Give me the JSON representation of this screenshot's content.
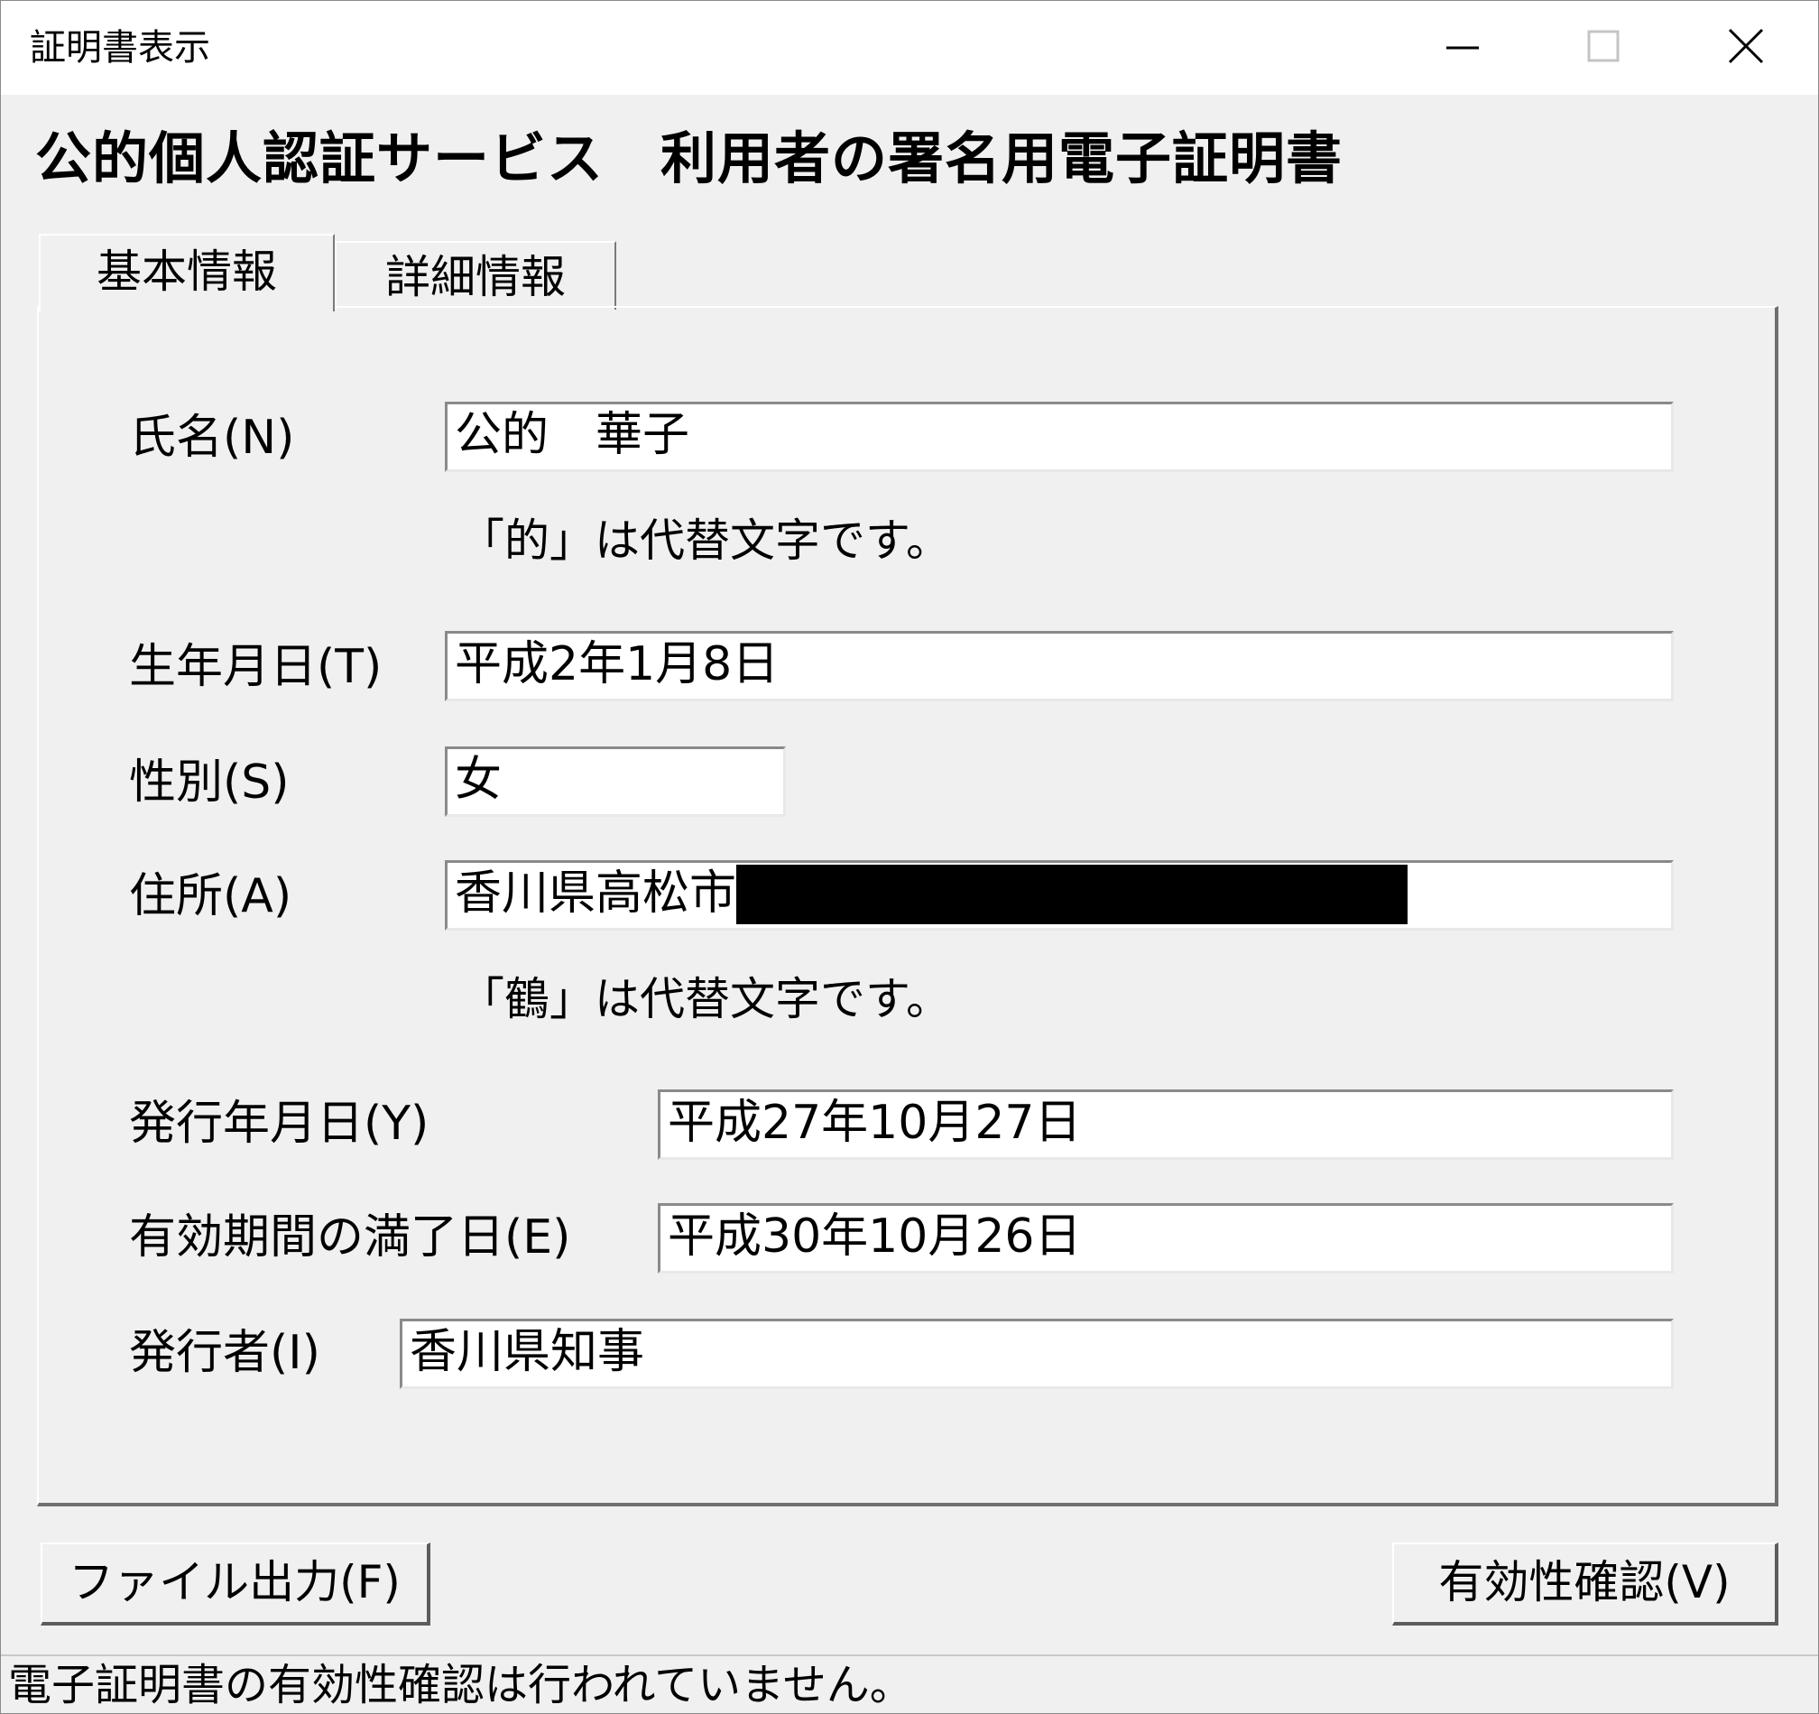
{
  "window": {
    "title": "証明書表示",
    "controls": {
      "minimize": "minimize-icon",
      "maximize": "maximize-icon",
      "close": "close-icon"
    }
  },
  "heading": "公的個人認証サービス　利用者の署名用電子証明書",
  "tabs": [
    {
      "label": "基本情報",
      "selected": true
    },
    {
      "label": "詳細情報",
      "selected": false
    }
  ],
  "fields": {
    "name": {
      "label": "氏名(N)",
      "value": "公的　華子",
      "note": "「的」は代替文字です。"
    },
    "birthdate": {
      "label": "生年月日(T)",
      "value": "平成2年1月8日"
    },
    "gender": {
      "label": "性別(S)",
      "value": "女"
    },
    "address": {
      "label": "住所(A)",
      "value": "香川県高松市",
      "note": "「鶴」は代替文字です。"
    },
    "issue_date": {
      "label": "発行年月日(Y)",
      "value": "平成27年10月27日"
    },
    "expiry_date": {
      "label": "有効期間の満了日(E)",
      "value": "平成30年10月26日"
    },
    "issuer": {
      "label": "発行者(I)",
      "value": "香川県知事"
    }
  },
  "buttons": {
    "file_output": "ファイル出力(F)",
    "verify": "有効性確認(V)"
  },
  "status": "電子証明書の有効性確認は行われていません。"
}
